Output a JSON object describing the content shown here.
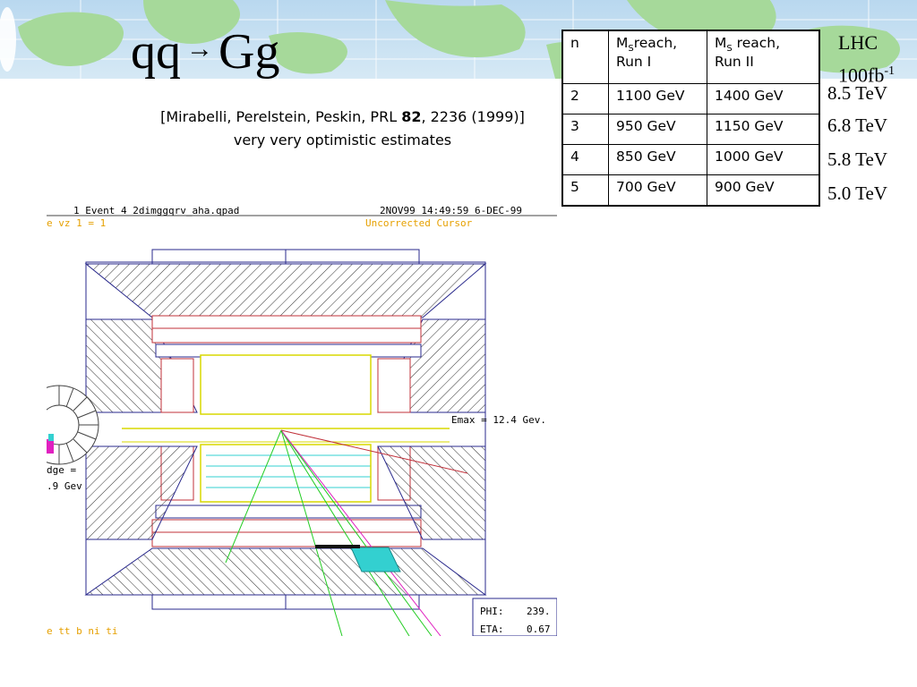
{
  "slide": {
    "title_left": "qq",
    "title_arrow": "→",
    "title_right": "Gg",
    "citation_pre": "[Mirabelli, Perelstein, Peskin, PRL ",
    "citation_vol": "82",
    "citation_post": ", 2236 (1999)]",
    "citation_note": "very very optimistic estimates"
  },
  "table": {
    "header": {
      "n": "n",
      "run1_M": "M",
      "run1_sub": "S",
      "run1_rest": "reach,",
      "run1_line2": "Run I",
      "run2_M": "M",
      "run2_sub": "S",
      "run2_rest": " reach,",
      "run2_line2": "Run II"
    },
    "rows": [
      {
        "n": "2",
        "run1": "1100 GeV",
        "run2": "1400 GeV"
      },
      {
        "n": "3",
        "run1": "950 GeV",
        "run2": "1150 GeV"
      },
      {
        "n": "4",
        "run1": "850 GeV",
        "run2": "1000 GeV"
      },
      {
        "n": "5",
        "run1": "700 GeV",
        "run2": "900 GeV"
      }
    ]
  },
  "lhc": {
    "title": "LHC",
    "lumi_base": "100fb",
    "lumi_exp": "-1",
    "values": [
      "8.5 TeV",
      "6.8 TeV",
      "5.8 TeV",
      "5.0 TeV"
    ]
  },
  "event_display": {
    "header_left": "1 Event     4  2dimggqrv_aha.qpad",
    "header_right": "2NOV99 14:49:59  6-DEC-99",
    "subheader_left": "e vz  1 =   1",
    "subheader_right": "Uncorrected Cursor",
    "emax": "Emax = 12.4 Gev.",
    "side_text_1": "dge =",
    "side_text_2": ".9 Gev",
    "phi_label": "PHI:",
    "phi_value": "239.",
    "eta_label": "ETA:",
    "eta_value": "0.67",
    "footer_text": "e  tt b  ni  ti"
  },
  "colors": {
    "detector_blue": "#2a2a8c",
    "calorimeter_red": "#c0303a",
    "track_green": "#22cc22",
    "beam_yellow": "#d8d800",
    "hit_cyan": "#33d0d0",
    "hit_magenta": "#e020c0"
  }
}
